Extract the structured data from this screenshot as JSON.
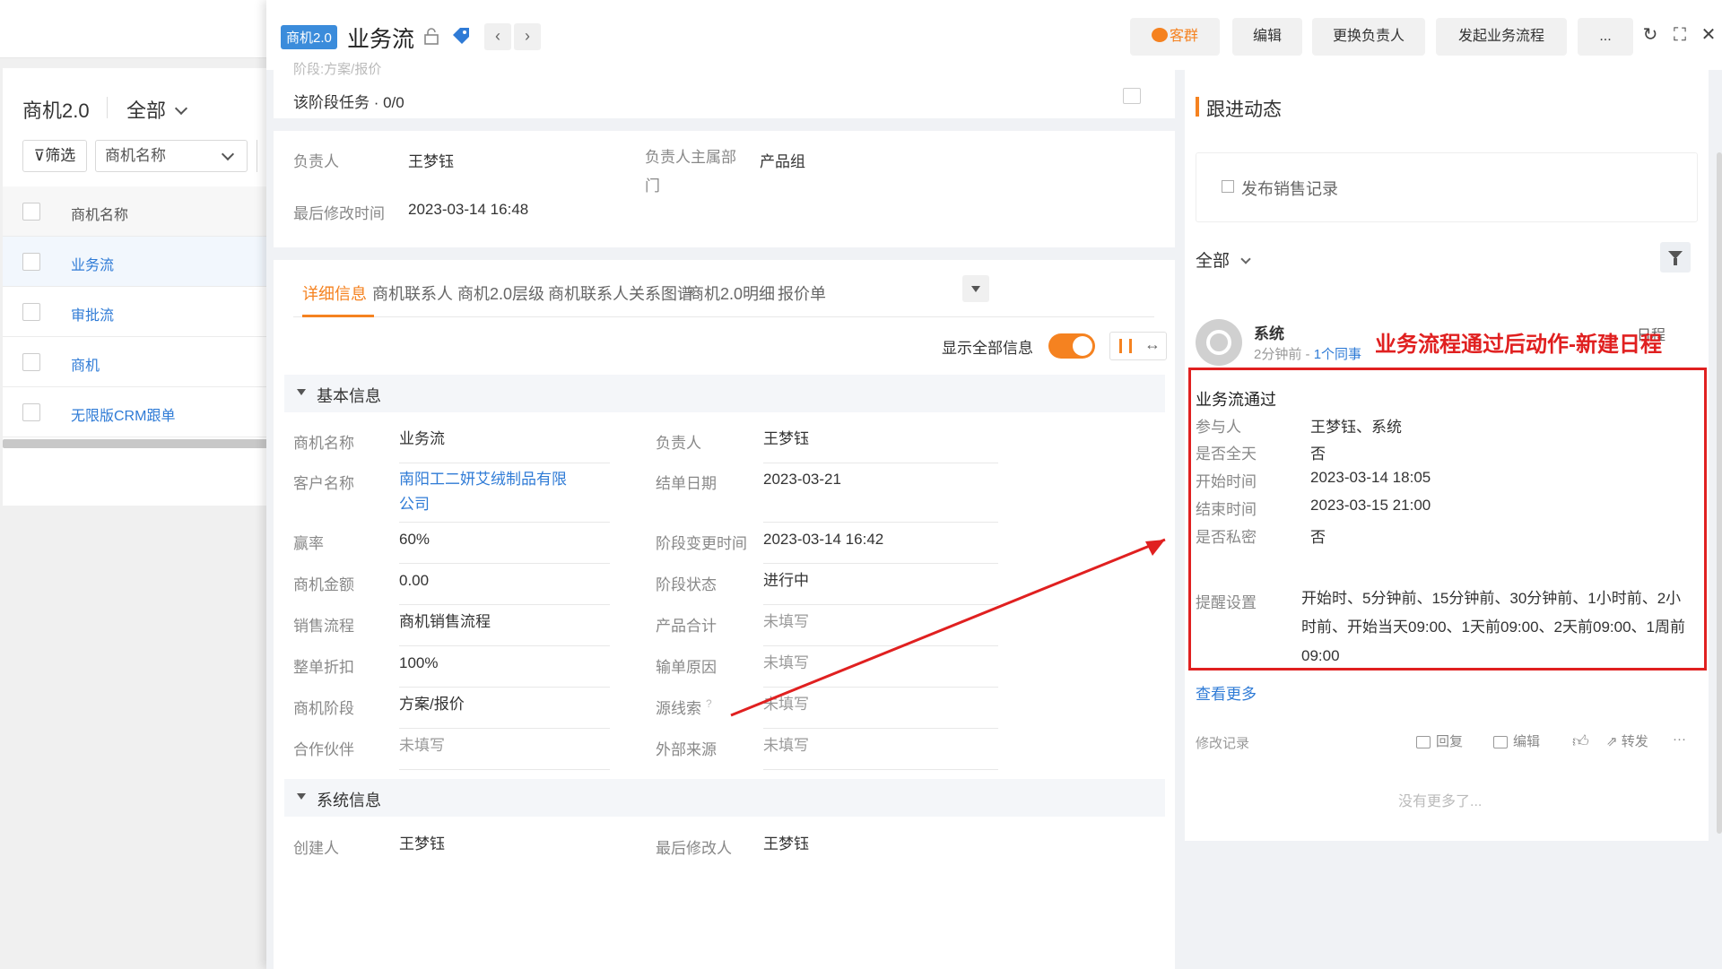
{
  "list": {
    "title": "商机2.0",
    "filter_all": "全部",
    "filter_button": "筛选",
    "select_field": "商机名称",
    "column_header": "商机名称",
    "rows": [
      "业务流",
      "审批流",
      "商机",
      "无限版CRM跟单"
    ]
  },
  "header": {
    "tag": "商机2.0",
    "title": "业务流",
    "btn_group": "客群",
    "btn_edit": "编辑",
    "btn_change_owner": "更换负责人",
    "btn_start_flow": "发起业务流程",
    "btn_more": "..."
  },
  "stage": {
    "faded_text": "阶段:方案/报价",
    "task": "该阶段任务 · 0/0"
  },
  "owner": {
    "owner_label": "负责人",
    "owner_value": "王梦钰",
    "dept_label": "负责人主属部门",
    "dept_value": "产品组",
    "modified_label": "最后修改时间",
    "modified_value": "2023-03-14 16:48"
  },
  "tabs": [
    "详细信息",
    "商机联系人",
    "商机2.0层级",
    "商机联系人关系图谱",
    "商机2.0明细",
    "报价单"
  ],
  "show_all_label": "显示全部信息",
  "basic_section": "基本信息",
  "system_section": "系统信息",
  "fields_left": [
    {
      "label": "商机名称",
      "value": "业务流",
      "type": "normal"
    },
    {
      "label": "客户名称",
      "value": "南阳工二妍艾绒制品有限公司",
      "type": "link"
    },
    {
      "label": "赢率",
      "value": "60%",
      "type": "normal"
    },
    {
      "label": "商机金额",
      "value": "0.00",
      "type": "normal"
    },
    {
      "label": "销售流程",
      "value": "商机销售流程",
      "type": "normal"
    },
    {
      "label": "整单折扣",
      "value": "100%",
      "type": "normal"
    },
    {
      "label": "商机阶段",
      "value": "方案/报价",
      "type": "normal"
    },
    {
      "label": "合作伙伴",
      "value": "未填写",
      "type": "empty"
    }
  ],
  "fields_right": [
    {
      "label": "负责人",
      "value": "王梦钰",
      "type": "normal"
    },
    {
      "label": "结单日期",
      "value": "2023-03-21",
      "type": "normal"
    },
    {
      "label": "阶段变更时间",
      "value": "2023-03-14 16:42",
      "type": "normal"
    },
    {
      "label": "阶段状态",
      "value": "进行中",
      "type": "normal"
    },
    {
      "label": "产品合计",
      "value": "未填写",
      "type": "empty"
    },
    {
      "label": "输单原因",
      "value": "未填写",
      "type": "empty"
    },
    {
      "label": "源线索",
      "value": "未填写",
      "type": "empty"
    },
    {
      "label": "外部来源",
      "value": "未填写",
      "type": "empty"
    }
  ],
  "system_fields": {
    "creator_label": "创建人",
    "creator_value": "王梦钰",
    "modifier_label": "最后修改人",
    "modifier_value": "王梦钰"
  },
  "feed": {
    "title": "跟进动态",
    "post_placeholder": "发布销售记录",
    "filter": "全部",
    "poster": "系统",
    "time": "2分钟前 - ",
    "colleague": "1个同事",
    "type_tag": "日程",
    "annotation": "业务流程通过后动作-新建日程",
    "event_title": "业务流通过",
    "event_fields": [
      {
        "label": "参与人",
        "value": "王梦钰、系统"
      },
      {
        "label": "是否全天",
        "value": "否"
      },
      {
        "label": "开始时间",
        "value": "2023-03-14 18:05"
      },
      {
        "label": "结束时间",
        "value": "2023-03-15 21:00"
      },
      {
        "label": "是否私密",
        "value": "否"
      }
    ],
    "remind_label": "提醒设置",
    "remind_value": "开始时、5分钟前、15分钟前、30分钟前、1小时前、2小时前、开始当天09:00、1天前09:00、2天前09:00、1周前09:00",
    "see_more": "查看更多",
    "modify_log": "修改记录",
    "actions": [
      "回复",
      "编辑",
      "转发"
    ],
    "no_more": "没有更多了..."
  },
  "colors": {
    "accent": "#f58220",
    "link": "#2f7bd6",
    "annotation": "#e02020"
  }
}
